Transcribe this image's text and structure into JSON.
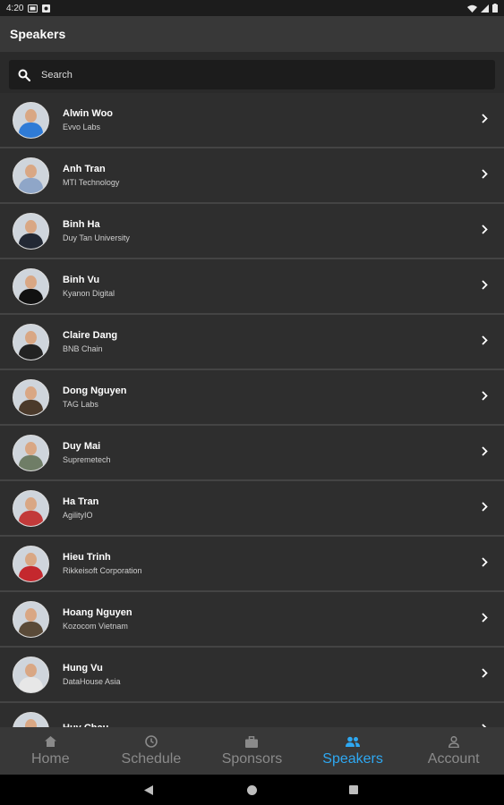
{
  "status_bar": {
    "time": "4:20"
  },
  "app_bar": {
    "title": "Speakers"
  },
  "search": {
    "placeholder": "Search"
  },
  "speakers": [
    {
      "name": "Alwin Woo",
      "company": "Evvo Labs",
      "shirt": "#2f7bd6"
    },
    {
      "name": "Anh Tran",
      "company": "MTI Technology",
      "shirt": "#8fa6c8"
    },
    {
      "name": "Binh Ha",
      "company": "Duy Tan University",
      "shirt": "#222834"
    },
    {
      "name": "Binh Vu",
      "company": "Kyanon Digital",
      "shirt": "#111"
    },
    {
      "name": "Claire Dang",
      "company": "BNB Chain",
      "shirt": "#222"
    },
    {
      "name": "Dong Nguyen",
      "company": "TAG Labs",
      "shirt": "#4b3a2b"
    },
    {
      "name": "Duy Mai",
      "company": "Supremetech",
      "shirt": "#6f7d66"
    },
    {
      "name": "Ha Tran",
      "company": "AgilityIO",
      "shirt": "#c23a3a"
    },
    {
      "name": "Hieu Trinh",
      "company": "Rikkeisoft Corporation",
      "shirt": "#c4282e"
    },
    {
      "name": "Hoang Nguyen",
      "company": "Kozocom Vietnam",
      "shirt": "#5a4a38"
    },
    {
      "name": "Hung Vu",
      "company": "DataHouse Asia",
      "shirt": "#e7e7e7"
    },
    {
      "name": "Huy Chau",
      "company": "",
      "shirt": "#555"
    }
  ],
  "bottom_nav": [
    {
      "label": "Home",
      "icon": "home-icon",
      "active": false
    },
    {
      "label": "Schedule",
      "icon": "clock-icon",
      "active": false
    },
    {
      "label": "Sponsors",
      "icon": "briefcase-icon",
      "active": false
    },
    {
      "label": "Speakers",
      "icon": "people-icon",
      "active": true
    },
    {
      "label": "Account",
      "icon": "person-icon",
      "active": false
    }
  ],
  "colors": {
    "accent": "#2ea8f2",
    "inactive": "#8a8a8a"
  }
}
